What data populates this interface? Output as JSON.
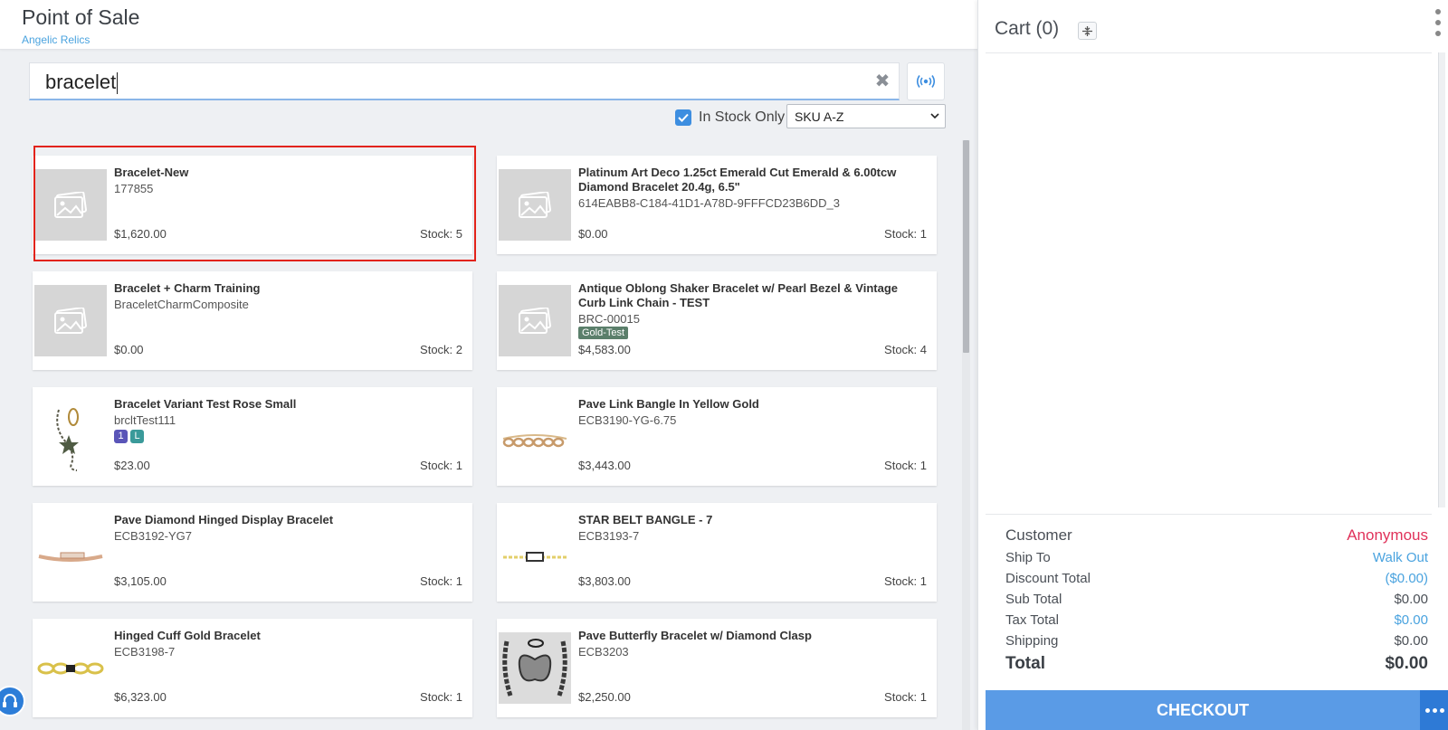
{
  "header": {
    "title": "Point of Sale",
    "subtitle": "Angelic Relics"
  },
  "search": {
    "value": "bracelet",
    "clear_icon": "close-icon",
    "rfid_icon": "rfid-icon"
  },
  "filters": {
    "in_stock_label": "In Stock Only",
    "in_stock_checked": true,
    "sort_selected": "SKU A-Z"
  },
  "products": [
    {
      "name": "Bracelet-New",
      "sku": "177855",
      "price": "$1,620.00",
      "stock": "Stock: 5",
      "image": "placeholder",
      "highlighted": true
    },
    {
      "name": "Platinum Art Deco 1.25ct Emerald Cut Emerald & 6.00tcw Diamond Bracelet 20.4g, 6.5\"",
      "sku": "614EABB8-C184-41D1-A78D-9FFFCD23B6DD_3",
      "price": "$0.00",
      "stock": "Stock: 1",
      "image": "placeholder"
    },
    {
      "name": "Bracelet + Charm Training",
      "sku": "BraceletCharmComposite",
      "price": "$0.00",
      "stock": "Stock: 2",
      "image": "placeholder"
    },
    {
      "name": "Antique Oblong Shaker Bracelet w/ Pearl Bezel & Vintage Curb Link Chain - TEST",
      "sku": "BRC-00015",
      "tag": "Gold-Test",
      "price": "$4,583.00",
      "stock": "Stock: 4",
      "image": "placeholder"
    },
    {
      "name": "Bracelet Variant Test Rose Small",
      "sku": "brcltTest111",
      "badges": [
        "1",
        "L"
      ],
      "price": "$23.00",
      "stock": "Stock: 1",
      "image": "charm-bracelet"
    },
    {
      "name": "Pave Link Bangle In Yellow Gold",
      "sku": "ECB3190-YG-6.75",
      "price": "$3,443.00",
      "stock": "Stock: 1",
      "image": "link-bangle"
    },
    {
      "name": "Pave Diamond Hinged Display Bracelet",
      "sku": "ECB3192-YG7",
      "price": "$3,105.00",
      "stock": "Stock: 1",
      "image": "hinged-bracelet"
    },
    {
      "name": "STAR BELT BANGLE - 7",
      "sku": "ECB3193-7",
      "price": "$3,803.00",
      "stock": "Stock: 1",
      "image": "belt-bangle"
    },
    {
      "name": "Hinged Cuff Gold Bracelet",
      "sku": "ECB3198-7",
      "price": "$6,323.00",
      "stock": "Stock: 1",
      "image": "cuff-bracelet"
    },
    {
      "name": "Pave Butterfly Bracelet w/ Diamond Clasp",
      "sku": "ECB3203",
      "price": "$2,250.00",
      "stock": "Stock: 1",
      "image": "butterfly-bracelet"
    }
  ],
  "cart": {
    "title": "Cart (0)",
    "customer_label": "Customer",
    "customer_value": "Anonymous",
    "ship_to_label": "Ship To",
    "ship_to_value": "Walk Out",
    "discount_label": "Discount Total",
    "discount_value": "($0.00)",
    "subtotal_label": "Sub Total",
    "subtotal_value": "$0.00",
    "tax_label": "Tax Total",
    "tax_value": "$0.00",
    "shipping_label": "Shipping",
    "shipping_value": "$0.00",
    "total_label": "Total",
    "total_value": "$0.00",
    "checkout_label": "CHECKOUT"
  },
  "colors": {
    "accent": "#5a9be6",
    "link": "#4aa3df",
    "customer": "#e0325a",
    "highlight": "#e2231a"
  }
}
